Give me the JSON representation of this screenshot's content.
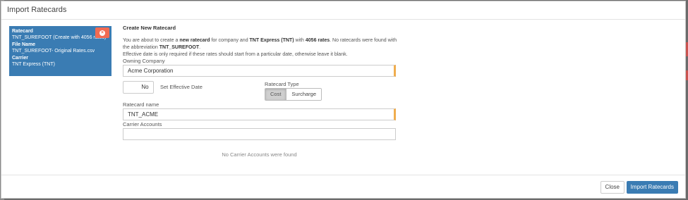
{
  "modal": {
    "title": "Import Ratecards"
  },
  "sidebar_card": {
    "ratecard_label": "Ratecard",
    "ratecard_value": "TNT_SUREFOOT (Create with 4056 rates)",
    "filename_label": "File Name",
    "filename_value": "TNT_SUREFOOT- Original Rates.csv",
    "carrier_label": "Carrier",
    "carrier_value": "TNT Express (TNT)",
    "remove_icon": "times-circle-icon",
    "accent_color": "#3a7cb3",
    "remove_color": "#f26b52"
  },
  "form": {
    "section_title": "Create New Ratecard",
    "intro": {
      "p1": "You are about to create a ",
      "b1": "new ratecard",
      "p2": " for company and ",
      "b2": "TNT Express (TNT)",
      "p3": " with ",
      "b3": "4056 rates",
      "p4": ". No ratecards were found with the abbreviation ",
      "b4": "TNT_SUREFOOT",
      "p5": ".",
      "line2": "Effective date is only required if these rates should start from a particular date, otherwise leave it blank."
    },
    "owning_company_label": "Owning Company",
    "owning_company_value": "Acme Corporation",
    "effective_toggle_value": "No",
    "effective_date_label": "Set Effective Date",
    "ratecard_type_label": "Ratecard Type",
    "ratecard_type_options": [
      "Cost",
      "Surcharge"
    ],
    "ratecard_type_selected": "Cost",
    "ratecard_name_label": "Ratecard name",
    "ratecard_name_value": "TNT_ACME",
    "carrier_accounts_label": "Carrier Accounts",
    "carrier_accounts_value": "",
    "empty_message": "No Carrier Accounts were found",
    "required_color": "#f0ad4e"
  },
  "footer": {
    "close_label": "Close",
    "import_label": "Import Ratecards"
  }
}
